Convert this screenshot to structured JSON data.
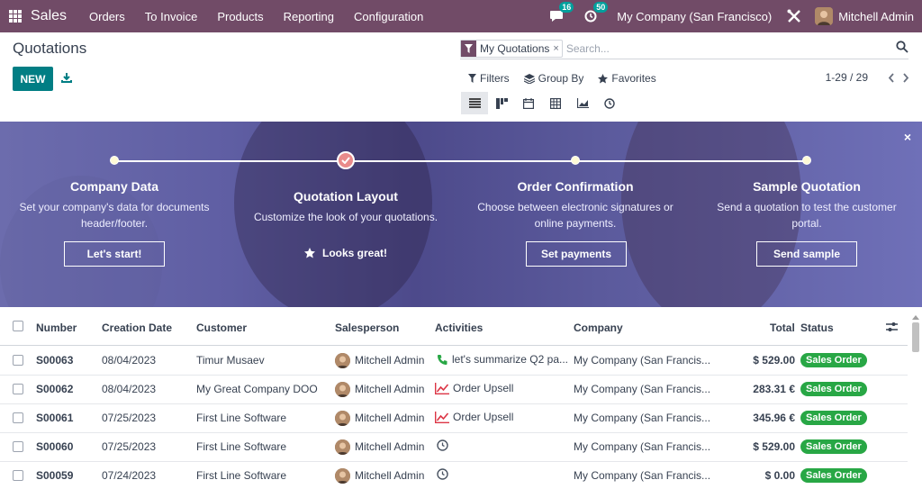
{
  "navbar": {
    "app_name": "Sales",
    "menu": [
      "Orders",
      "To Invoice",
      "Products",
      "Reporting",
      "Configuration"
    ],
    "messages_count": "16",
    "activities_count": "50",
    "company": "My Company (San Francisco)",
    "user": "Mitchell Admin",
    "bg_color": "#714b67"
  },
  "control_panel": {
    "title": "Quotations",
    "new_label": "NEW",
    "search": {
      "facet": "My Quotations",
      "facet_close": "×",
      "placeholder": "Search..."
    },
    "filters_label": "Filters",
    "group_by_label": "Group By",
    "favorites_label": "Favorites",
    "pager": "1-29 / 29",
    "views": [
      "list-icon",
      "kanban-icon",
      "calendar-icon",
      "pivot-icon",
      "graph-icon",
      "activity-icon"
    ]
  },
  "onboarding": {
    "close": "×",
    "steps": [
      {
        "title": "Company Data",
        "desc_line1": "Set your company's data for documents",
        "desc_line2": "header/footer.",
        "button": "Let's start!"
      },
      {
        "title": "Quotation Layout",
        "desc_line1": "Customize the look of your quotations.",
        "done_label": "Looks great!"
      },
      {
        "title": "Order Confirmation",
        "desc_line1": "Choose between electronic signatures or",
        "desc_line2": "online payments.",
        "button": "Set payments"
      },
      {
        "title": "Sample Quotation",
        "desc_line1": "Send a quotation to test the customer",
        "desc_line2": "portal.",
        "button": "Send sample"
      }
    ]
  },
  "table": {
    "columns": {
      "number": "Number",
      "creation_date": "Creation Date",
      "customer": "Customer",
      "salesperson": "Salesperson",
      "activities": "Activities",
      "company": "Company",
      "total": "Total",
      "status": "Status"
    },
    "rows": [
      {
        "number": "S00063",
        "date": "08/04/2023",
        "customer": "Timur Musaev",
        "salesperson": "Mitchell Admin",
        "activity": "let's summarize Q2 pa...",
        "activity_icon": "phone-icon",
        "company": "My Company (San Francis...",
        "total": "$ 529.00",
        "status": "Sales Order"
      },
      {
        "number": "S00062",
        "date": "08/04/2023",
        "customer": "My Great Company DOO",
        "salesperson": "Mitchell Admin",
        "activity": "Order Upsell",
        "activity_icon": "upsell-icon",
        "company": "My Company (San Francis...",
        "total": "283.31 €",
        "status": "Sales Order"
      },
      {
        "number": "S00061",
        "date": "07/25/2023",
        "customer": "First Line Software",
        "salesperson": "Mitchell Admin",
        "activity": "Order Upsell",
        "activity_icon": "upsell-icon",
        "company": "My Company (San Francis...",
        "total": "345.96 €",
        "status": "Sales Order"
      },
      {
        "number": "S00060",
        "date": "07/25/2023",
        "customer": "First Line Software",
        "salesperson": "Mitchell Admin",
        "activity": "",
        "activity_icon": "clock-icon",
        "company": "My Company (San Francis...",
        "total": "$ 529.00",
        "status": "Sales Order"
      },
      {
        "number": "S00059",
        "date": "07/24/2023",
        "customer": "First Line Software",
        "salesperson": "Mitchell Admin",
        "activity": "",
        "activity_icon": "clock-icon",
        "company": "My Company (San Francis...",
        "total": "$ 0.00",
        "status": "Sales Order"
      }
    ]
  },
  "colors": {
    "primary": "#017e84",
    "status_green": "#28a745",
    "banner": "#5f5ea3"
  }
}
